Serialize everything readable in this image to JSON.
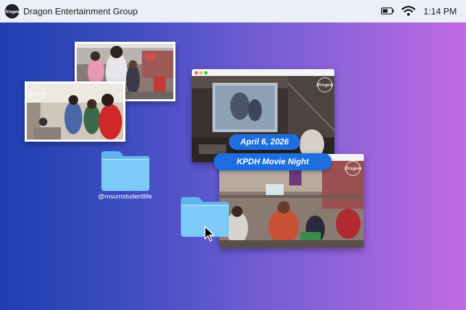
{
  "menubar": {
    "logo_text": "Dragon",
    "app_title": "Dragon Entertainment Group",
    "time": "1:14 PM",
    "icons": [
      "battery-icon",
      "wifi-icon"
    ]
  },
  "event": {
    "date": "April 6, 2026",
    "title": "KPDH Movie Night"
  },
  "desktop": {
    "folder_label": "@msumstudentlife"
  },
  "watermark_text": "Dragon",
  "colors": {
    "pill_blue": "#1a73e8",
    "folder_blue": "#7cc8f8"
  }
}
